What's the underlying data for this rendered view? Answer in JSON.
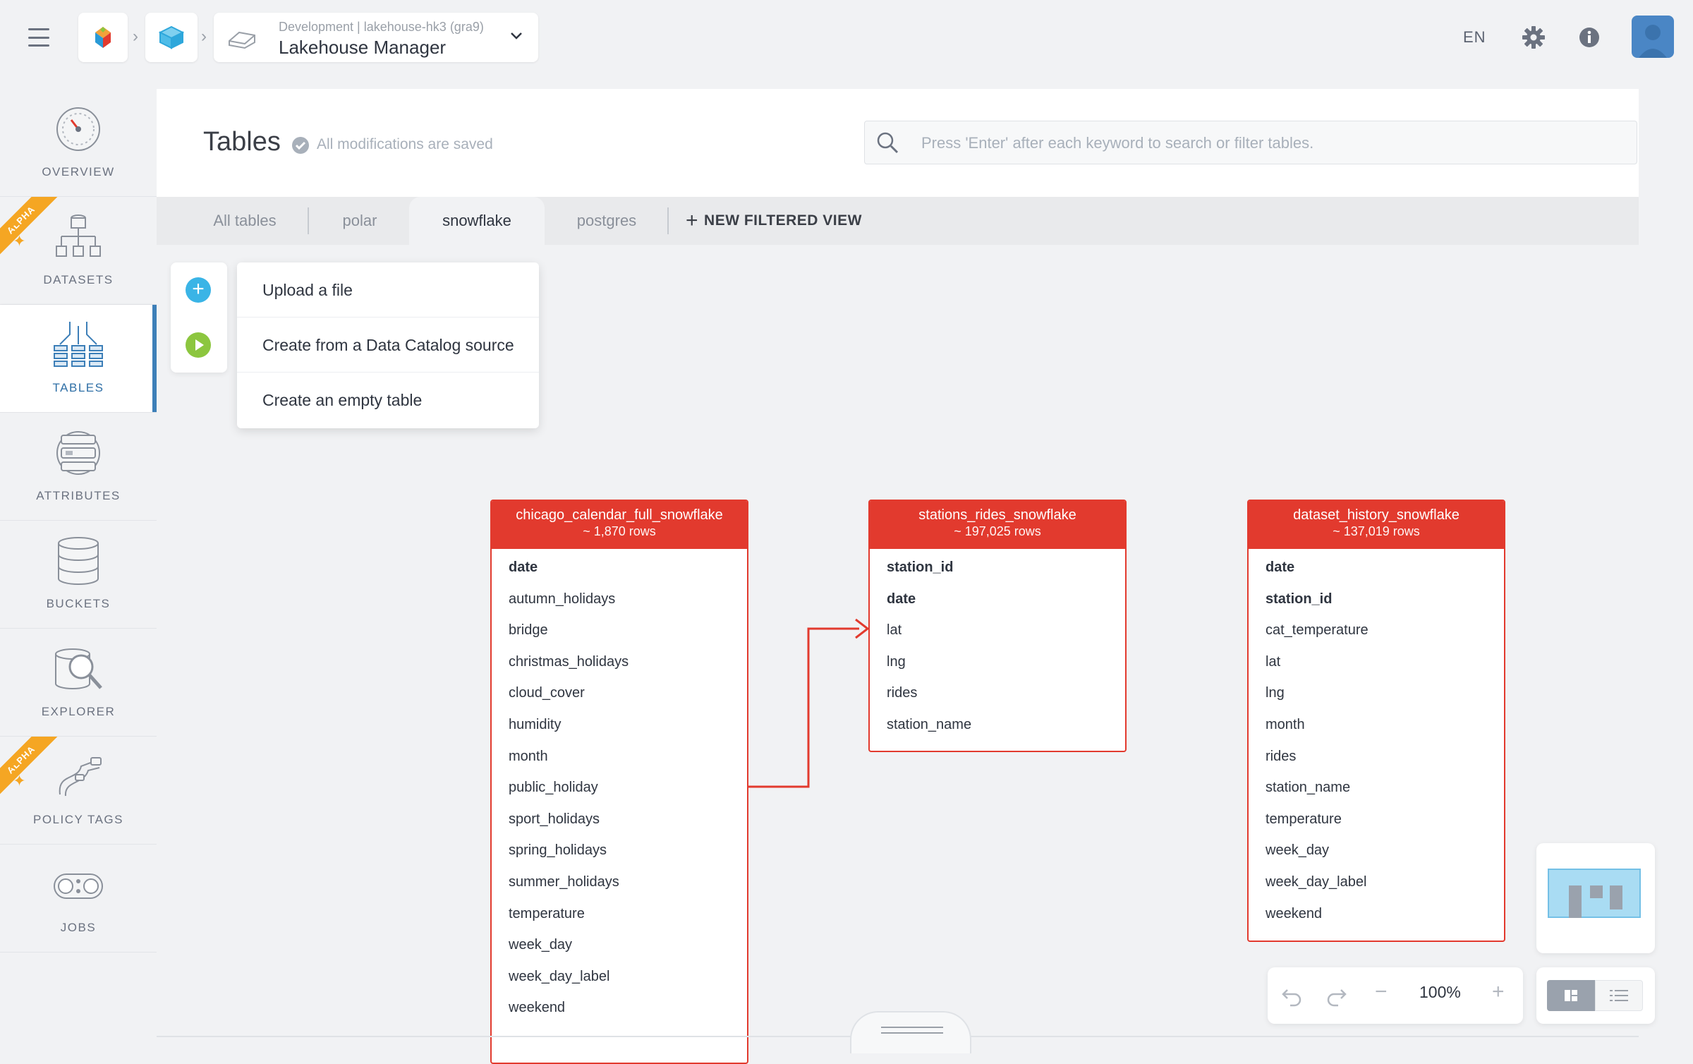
{
  "topbar": {
    "environment": "Development | lakehouse-hk3 (gra9)",
    "app_name": "Lakehouse Manager",
    "language": "EN",
    "icons": [
      "menu-icon",
      "product-logo-icon",
      "cube-icon",
      "cloud-icon",
      "chevron-down-icon",
      "gear-icon",
      "info-icon",
      "avatar"
    ]
  },
  "sidebar": {
    "items": [
      {
        "label": "OVERVIEW",
        "icon": "speedometer-icon",
        "alpha": false
      },
      {
        "label": "DATASETS",
        "icon": "dataset-tree-icon",
        "alpha": true
      },
      {
        "label": "TABLES",
        "icon": "tables-icon",
        "alpha": false,
        "active": true
      },
      {
        "label": "ATTRIBUTES",
        "icon": "attributes-icon",
        "alpha": false
      },
      {
        "label": "BUCKETS",
        "icon": "database-icon",
        "alpha": false
      },
      {
        "label": "EXPLORER",
        "icon": "explorer-magnifier-icon",
        "alpha": false
      },
      {
        "label": "POLICY TAGS",
        "icon": "policy-tags-icon",
        "alpha": true
      },
      {
        "label": "JOBS",
        "icon": "jobs-conveyor-icon",
        "alpha": false
      }
    ],
    "alpha_badge": "ALPHA"
  },
  "header": {
    "title": "Tables",
    "saved_status": "All modifications are saved",
    "search_placeholder": "Press 'Enter' after each keyword to search or filter tables."
  },
  "tabs": {
    "items": [
      "All tables",
      "polar",
      "snowflake",
      "postgres"
    ],
    "active": "snowflake",
    "new_view": "NEW FILTERED VIEW"
  },
  "add_menu": {
    "items": [
      "Upload a file",
      "Create from a Data Catalog source",
      "Create an empty table"
    ]
  },
  "tables": [
    {
      "name": "chicago_calendar_full_snowflake",
      "rows": "~ 1,870 rows",
      "columns": [
        "date",
        "autumn_holidays",
        "bridge",
        "christmas_holidays",
        "cloud_cover",
        "humidity",
        "month",
        "public_holiday",
        "sport_holidays",
        "spring_holidays",
        "summer_holidays",
        "temperature",
        "week_day",
        "week_day_label",
        "weekend"
      ],
      "key_columns": [
        "date"
      ]
    },
    {
      "name": "stations_rides_snowflake",
      "rows": "~ 197,025 rows",
      "columns": [
        "station_id",
        "date",
        "lat",
        "lng",
        "rides",
        "station_name"
      ],
      "key_columns": [
        "station_id",
        "date"
      ]
    },
    {
      "name": "dataset_history_snowflake",
      "rows": "~ 137,019 rows",
      "columns": [
        "date",
        "station_id",
        "cat_temperature",
        "lat",
        "lng",
        "month",
        "rides",
        "station_name",
        "temperature",
        "week_day",
        "week_day_label",
        "weekend"
      ],
      "key_columns": [
        "date",
        "station_id"
      ]
    }
  ],
  "relations": [
    {
      "from_table": "chicago_calendar_full_snowflake",
      "to_table": "stations_rides_snowflake",
      "to_column": "lat"
    }
  ],
  "zoom": {
    "level": "100%",
    "controls": [
      "undo-icon",
      "redo-icon",
      "zoom-out-icon",
      "zoom-in-icon"
    ]
  },
  "colors": {
    "accent": "#e23a2e",
    "active_nav": "#3d7fb8",
    "upload": "#3ab4e6",
    "catalog": "#8cc63f",
    "alpha": "#f5a623"
  }
}
